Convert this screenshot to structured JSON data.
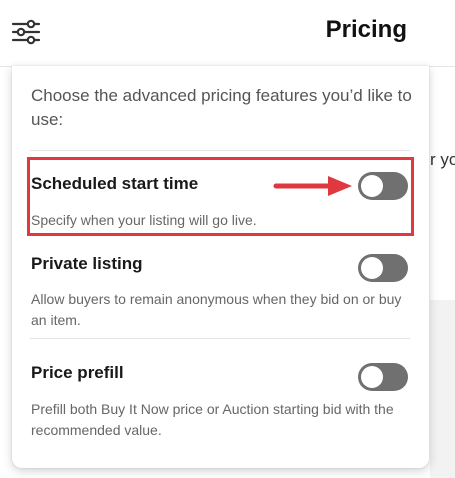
{
  "header": {
    "title": "Pricing",
    "settings_icon": "sliders-icon"
  },
  "background": {
    "partial_text": "r yo"
  },
  "popover": {
    "intro": "Choose the advanced pricing features you’d like to use:",
    "features": [
      {
        "title": "Scheduled start time",
        "description": "Specify when your listing will go live.",
        "enabled": false
      },
      {
        "title": "Private listing",
        "description": "Allow buyers to remain anonymous when they bid on or buy an item.",
        "enabled": false
      },
      {
        "title": "Price prefill",
        "description": "Prefill both Buy It Now price or Auction starting bid with the recommended value.",
        "enabled": false
      }
    ]
  },
  "annotation": {
    "color": "#e0383e",
    "arrow_icon": "right-arrow-icon"
  },
  "colors": {
    "toggle_off": "#707070",
    "text_primary": "#191919",
    "text_secondary": "#666666"
  }
}
